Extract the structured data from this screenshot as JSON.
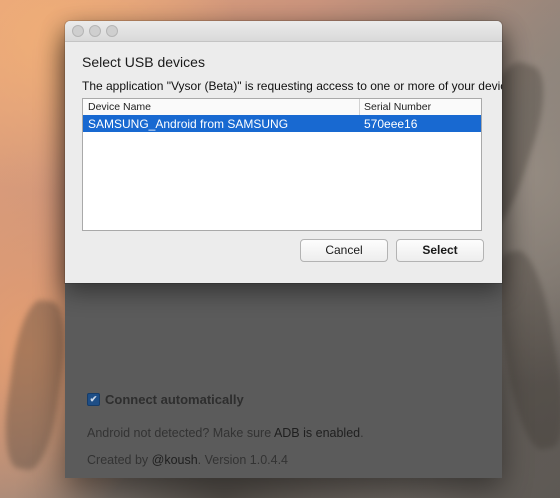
{
  "dialog": {
    "title": "Select USB devices",
    "message": "The application \"Vysor (Beta)\" is requesting access to one or more of your devices",
    "table": {
      "columns": [
        "Device Name",
        "Serial Number"
      ],
      "rows": [
        {
          "device_name": "SAMSUNG_Android from SAMSUNG",
          "serial_number": "570eee16",
          "selected": true
        }
      ]
    },
    "cancel_label": "Cancel",
    "select_label": "Select"
  },
  "app": {
    "connect_auto_label": "Connect automatically",
    "connect_auto_checked": true,
    "adb_prefix": "Android not detected? Make sure ",
    "adb_link": "ADB is enabled",
    "adb_suffix": ".",
    "created_prefix": "Created by ",
    "created_author": "@koush",
    "created_suffix": ". Version 1.0.4.4"
  },
  "colors": {
    "selection": "#1869d1",
    "checkbox": "#1e4e86"
  }
}
